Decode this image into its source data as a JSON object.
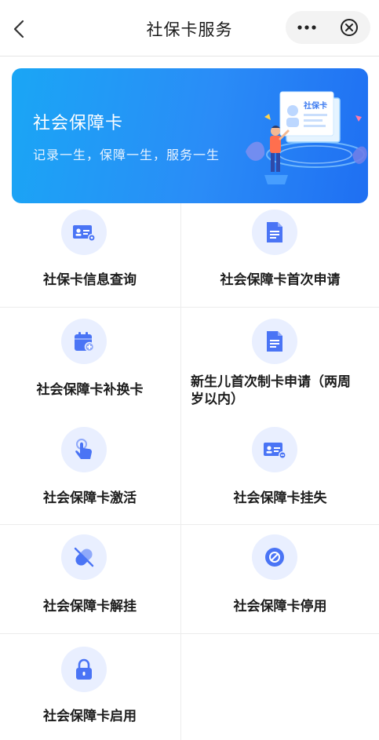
{
  "navbar": {
    "title": "社保卡服务",
    "back_icon": "chevron-left-icon",
    "more_icon": "more-dots-icon",
    "close_icon": "close-circle-icon"
  },
  "banner": {
    "title": "社会保障卡",
    "subtitle": "记录一生，保障一生，服务一生",
    "card_text": "社保卡",
    "colors": {
      "start": "#1aa6f5",
      "end": "#1f6ff2"
    }
  },
  "services": [
    {
      "label": "社保卡信息查询",
      "icon": "id-card-icon"
    },
    {
      "label": "社会保障卡首次申请",
      "icon": "document-icon"
    },
    {
      "label": "社会保障卡补换卡",
      "icon": "calendar-plus-icon"
    },
    {
      "label": "新生儿首次制卡申请（两周岁以内）",
      "icon": "document-icon"
    },
    {
      "label": "社会保障卡激活",
      "icon": "hand-tap-icon"
    },
    {
      "label": "社会保障卡挂失",
      "icon": "id-card-icon"
    },
    {
      "label": "社会保障卡解挂",
      "icon": "pill-icon"
    },
    {
      "label": "社会保障卡停用",
      "icon": "stop-circle-icon"
    },
    {
      "label": "社会保障卡启用",
      "icon": "lock-icon"
    }
  ],
  "accent_color": "#4a74f5"
}
